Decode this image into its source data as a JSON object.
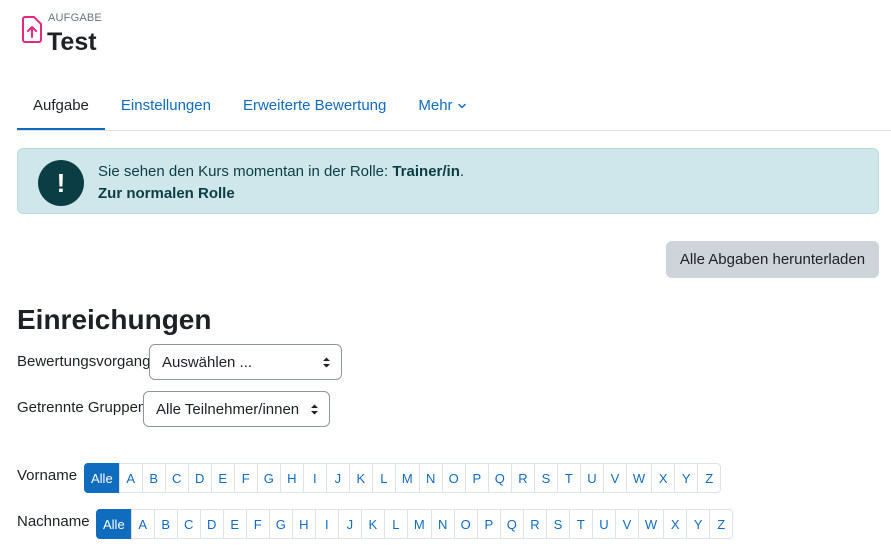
{
  "header": {
    "activity_type": "AUFGABE",
    "title": "Test",
    "icon": "assignment-upload-icon",
    "icon_color": "#e6287e"
  },
  "tabs": [
    {
      "label": "Aufgabe",
      "active": true
    },
    {
      "label": "Einstellungen",
      "active": false
    },
    {
      "label": "Erweiterte Bewertung",
      "active": false
    },
    {
      "label": "Mehr",
      "active": false,
      "dropdown": true
    }
  ],
  "alert": {
    "text_prefix": "Sie sehen den Kurs momentan in der Rolle: ",
    "role": "Trainer/in",
    "text_suffix": ".",
    "link": "Zur normalen Rolle",
    "icon": "exclamation-icon"
  },
  "download_button": "Alle Abgaben herunterladen",
  "section_title": "Einreichungen",
  "grading_action": {
    "label": "Bewertungsvorgang",
    "value": "Auswählen ..."
  },
  "groups": {
    "label": "Getrennte Gruppen",
    "value": "Alle Teilnehmer/innen"
  },
  "firstname_filter": {
    "label": "Vorname",
    "all_label": "Alle",
    "letters": [
      "A",
      "B",
      "C",
      "D",
      "E",
      "F",
      "G",
      "H",
      "I",
      "J",
      "K",
      "L",
      "M",
      "N",
      "O",
      "P",
      "Q",
      "R",
      "S",
      "T",
      "U",
      "V",
      "W",
      "X",
      "Y",
      "Z"
    ]
  },
  "lastname_filter": {
    "label": "Nachname",
    "all_label": "Alle",
    "letters": [
      "A",
      "B",
      "C",
      "D",
      "E",
      "F",
      "G",
      "H",
      "I",
      "J",
      "K",
      "L",
      "M",
      "N",
      "O",
      "P",
      "Q",
      "R",
      "S",
      "T",
      "U",
      "V",
      "W",
      "X",
      "Y",
      "Z"
    ]
  },
  "colors": {
    "primary": "#0f6cbf",
    "alert_bg": "#cfe7ea",
    "alert_icon": "#0b3d45",
    "button_bg": "#ced4da"
  }
}
